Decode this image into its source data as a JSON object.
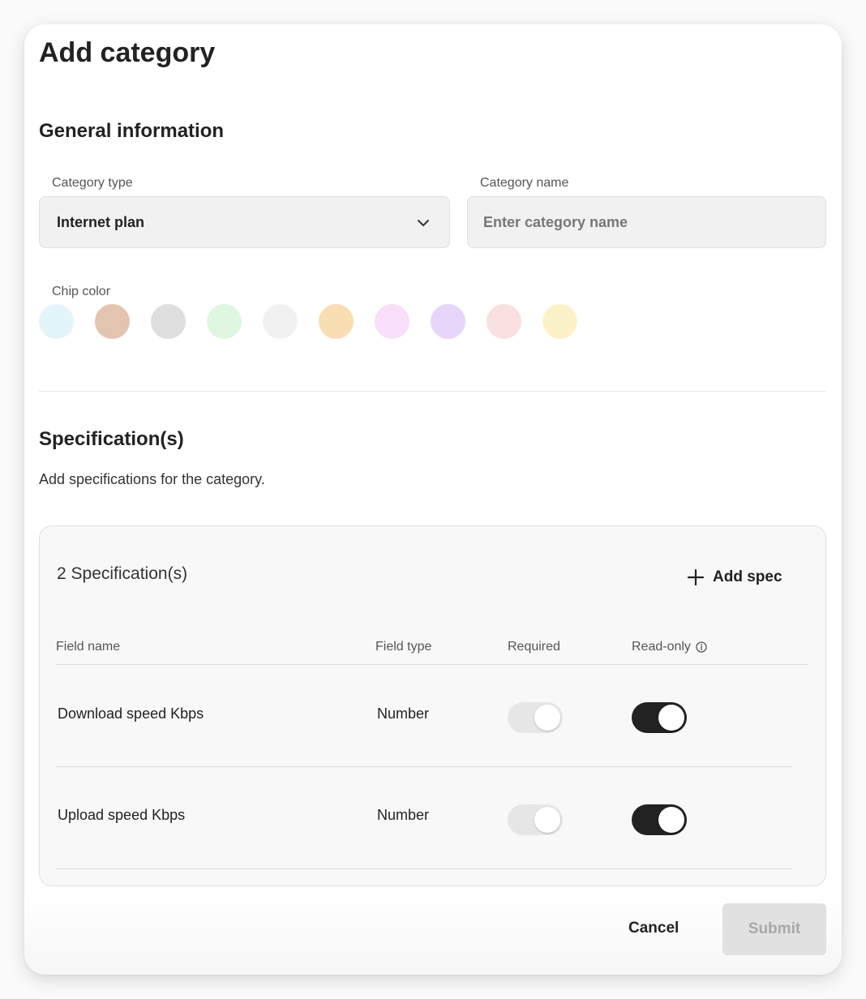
{
  "dialog": {
    "title": "Add category",
    "general": {
      "heading": "General information",
      "category_type": {
        "label": "Category type",
        "value": "Internet plan",
        "icon": "chevron-down-icon"
      },
      "category_name": {
        "label": "Category name",
        "placeholder": "Enter category name",
        "value": ""
      },
      "chip_color": {
        "label": "Chip color",
        "colors": [
          "#e3f5fb",
          "#e3c4b1",
          "#dedede",
          "#dff6e0",
          "#f1f1f1",
          "#f8deb2",
          "#f9dff9",
          "#e7d5f9",
          "#f9e0e0",
          "#fcf2c8"
        ]
      }
    },
    "specs": {
      "heading": "Specification(s)",
      "description": "Add specifications for the category.",
      "count_label": "2 Specification(s)",
      "add_label": "Add spec",
      "add_icon": "plus-icon",
      "columns": [
        "Field name",
        "Field type",
        "Required",
        "Read-only"
      ],
      "readonly_info_icon": "info-icon",
      "rows": [
        {
          "field_name": "Download speed Kbps",
          "field_type": "Number",
          "required": false,
          "read_only": true
        },
        {
          "field_name": "Upload speed Kbps",
          "field_type": "Number",
          "required": false,
          "read_only": true
        }
      ]
    },
    "footer": {
      "cancel_label": "Cancel",
      "submit_label": "Submit"
    }
  }
}
